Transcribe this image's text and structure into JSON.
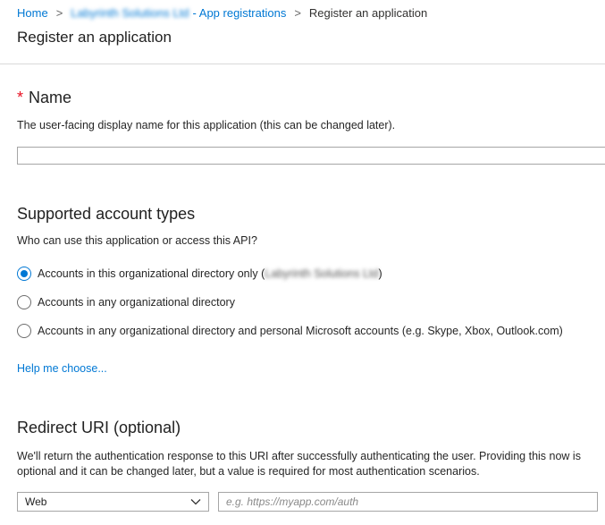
{
  "breadcrumb": {
    "home": "Home",
    "tenant": "Labyrinth Solutions Ltd",
    "app_registrations": "- App registrations",
    "current": "Register an application",
    "separator": ">"
  },
  "page_title": "Register an application",
  "name_section": {
    "required_mark": "*",
    "heading": "Name",
    "description": "The user-facing display name for this application (this can be changed later).",
    "value": ""
  },
  "account_types": {
    "heading": "Supported account types",
    "question": "Who can use this application or access this API?",
    "options": [
      {
        "label_prefix": "Accounts in this organizational directory only (",
        "tenant": "Labyrinth Solutions Ltd",
        "label_suffix": ")",
        "selected": true
      },
      {
        "label": "Accounts in any organizational directory",
        "selected": false
      },
      {
        "label": "Accounts in any organizational directory and personal Microsoft accounts (e.g. Skype, Xbox, Outlook.com)",
        "selected": false
      }
    ],
    "help_link": "Help me choose..."
  },
  "redirect_uri": {
    "heading": "Redirect URI (optional)",
    "description": "We'll return the authentication response to this URI after successfully authenticating the user. Providing this now is optional and it can be changed later, but a value is required for most authentication scenarios.",
    "platform_selected": "Web",
    "uri_placeholder": "e.g. https://myapp.com/auth",
    "uri_value": ""
  },
  "colors": {
    "accent": "#0078d4",
    "required": "#e81123"
  },
  "icons": {
    "breadcrumb_separator": "chevron-right-icon",
    "select_chevron": "chevron-down-icon"
  }
}
